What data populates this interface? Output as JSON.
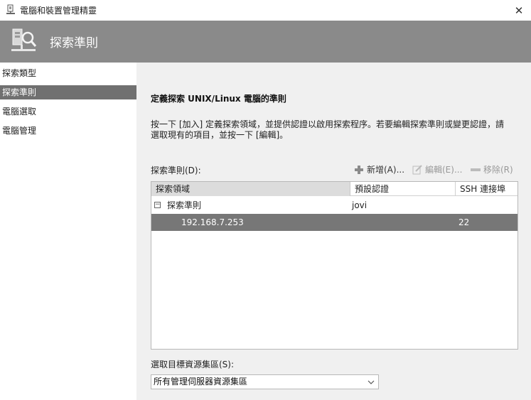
{
  "window": {
    "title": "電腦和裝置管理精靈",
    "close_glyph": "✕"
  },
  "banner": {
    "title": "探索準則"
  },
  "sidebar": {
    "items": [
      {
        "label": "探索類型",
        "active": false
      },
      {
        "label": "探索準則",
        "active": true
      },
      {
        "label": "電腦選取",
        "active": false
      },
      {
        "label": "電腦管理",
        "active": false
      }
    ]
  },
  "main": {
    "section_title": "定義探索 UNIX/Linux 電腦的準則",
    "description": "按一下 [加入] 定義探索領域，並提供認證以啟用探索程序。若要編輯探索準則或變更認證，請選取現有的項目，並按一下 [編輯]。",
    "list_label": "探索準則(D):",
    "toolbar": {
      "add_label": "新增(A)...",
      "edit_label": "編輯(E)...",
      "remove_label": "移除(R)"
    },
    "grid": {
      "columns": [
        "探索領域",
        "預設認證",
        "SSH 連接埠"
      ],
      "group": {
        "toggle": "−",
        "name": "探索準則",
        "credential": "jovi"
      },
      "rows": [
        {
          "domain": "192.168.7.253",
          "credential": "",
          "port": "22",
          "selected": true
        }
      ]
    },
    "pool_label": "選取目標資源集區(S):",
    "pool_select": {
      "selected": "所有管理伺服器資源集區"
    }
  },
  "colors": {
    "banner_bg": "#8a8a8a",
    "selection_bg": "#777777",
    "content_bg": "#f0f0f0"
  }
}
